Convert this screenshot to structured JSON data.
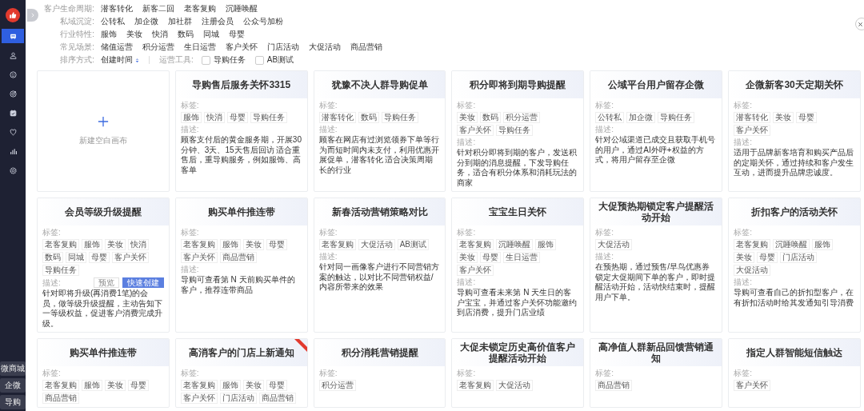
{
  "sidebar": {
    "items": [
      {
        "selected": true
      },
      {
        "selected": false
      },
      {
        "selected": false
      },
      {
        "selected": false
      },
      {
        "selected": false
      },
      {
        "selected": false
      },
      {
        "selected": false
      },
      {
        "selected": false
      }
    ],
    "bottom_links": [
      "微商城",
      "企微",
      "导购"
    ]
  },
  "filters": [
    {
      "label": "客户生命周期:",
      "options": [
        "潜客转化",
        "新客二回",
        "老客复购",
        "沉睡唤醒"
      ]
    },
    {
      "label": "私域沉淀:",
      "options": [
        "公转私",
        "加企微",
        "加社群",
        "注册会员",
        "公众号加粉"
      ]
    },
    {
      "label": "行业特性:",
      "options": [
        "服饰",
        "美妆",
        "快消",
        "数码",
        "同城",
        "母婴"
      ]
    },
    {
      "label": "常见场景:",
      "options": [
        "储值运营",
        "积分运营",
        "生日运营",
        "客户关怀",
        "门店活动",
        "大促活动",
        "商品营销"
      ]
    }
  ],
  "sort": {
    "label": "排序方式:",
    "value": "创建时间",
    "tools_label": "运营工具:",
    "tools": [
      {
        "label": "导购任务",
        "checked": false
      },
      {
        "label": "AB测试",
        "checked": false
      }
    ]
  },
  "cards": [
    {
      "kind": "new",
      "title": "新建空白画布"
    },
    {
      "kind": "template",
      "title": "导购售后服务关怀3315",
      "corner_badge": false,
      "tags_label": "标签:",
      "tags": [
        "服饰",
        "快消",
        "母婴",
        "导购任务"
      ],
      "desc_label": "描述:",
      "description": "顾客支付后的黄金服务期，开展30分钟、3天、15天售后回访 适合重售后，重导购服务，例如服饰、高客单"
    },
    {
      "kind": "template",
      "title": "犹豫不决人群导购促单",
      "corner_badge": false,
      "tags_label": "标签:",
      "tags": [
        "潜客转化",
        "数码",
        "导购任务"
      ],
      "desc_label": "描述:",
      "description": "顾客在网店有过浏览领券下单等行为而短时间内未支付，利用优惠开展促单，潜客转化 适合决策周期长的行业"
    },
    {
      "kind": "template",
      "title": "积分即将到期导购提醒",
      "corner_badge": false,
      "tags_label": "标签:",
      "tags": [
        "美妆",
        "数码",
        "积分运营",
        "客户关怀",
        "导购任务"
      ],
      "desc_label": "描述:",
      "description": "针对积分即将到期的客户，发送积分到期的消息提醒，下发导购任务，适合有积分体系和消耗玩法的商家"
    },
    {
      "kind": "template",
      "title": "公域平台用户留存企微",
      "corner_badge": false,
      "tags_label": "标签:",
      "tags": [
        "公转私",
        "加企微",
        "导购任务"
      ],
      "desc_label": "描述:",
      "description": "针对公域渠道已成交且获取手机号的用户，通过AI外呼+权益的方式，将用户留存至企微"
    },
    {
      "kind": "template",
      "title": "企微新客30天定期关怀",
      "corner_badge": false,
      "tags_label": "标签:",
      "tags": [
        "潜客转化",
        "美妆",
        "母婴",
        "客户关怀"
      ],
      "desc_label": "描述:",
      "description": "适用于品牌新客培育和购买产品后的定期关怀，通过持续和客户发生互动，进而提升品牌忠诚度。"
    },
    {
      "kind": "template",
      "title": "会员等级升级提醒",
      "corner_badge": false,
      "tags_label": "标签:",
      "tags": [
        "老客复购",
        "服饰",
        "美妆",
        "快消",
        "数码",
        "同城",
        "母婴",
        "客户关怀",
        "导购任务"
      ],
      "desc_label": "描述:",
      "description": "针对即将升级(再消费1笔)的会员，做等级升级提醒，主动告知下一等级权益，促进客户消费完成升级。",
      "actions": [
        {
          "label": "预览",
          "kind": "secondary"
        },
        {
          "label": "快速创建",
          "kind": "primary"
        }
      ]
    },
    {
      "kind": "template",
      "title": "购买单件推连带",
      "corner_badge": false,
      "tags_label": "标签:",
      "tags": [
        "老客复购",
        "服饰",
        "美妆",
        "母婴",
        "客户关怀",
        "商品营销"
      ],
      "desc_label": "描述:",
      "description": "导购可查看第 N 天前购买单件的客户，推荐连带商品"
    },
    {
      "kind": "template",
      "title": "新春活动营销策略对比",
      "corner_badge": false,
      "tags_label": "标签:",
      "tags": [
        "老客复购",
        "大促活动",
        "AB测试"
      ],
      "desc_label": "描述:",
      "description": "针对同一画像客户进行不同营销方案的触达，以对比不同营销权益/内容所带来的效果"
    },
    {
      "kind": "template",
      "title": "宝宝生日关怀",
      "corner_badge": false,
      "tags_label": "标签:",
      "tags": [
        "老客复购",
        "沉睡唤醒",
        "服饰",
        "美妆",
        "母婴",
        "生日运营",
        "客户关怀"
      ],
      "desc_label": "描述:",
      "description": "导购可查看未来第 N 天生日的客户宝宝，并通过客户关怀功能邀约到店消费，提升门店业绩"
    },
    {
      "kind": "template",
      "title": "大促预热期锁定客户提醒活动开始",
      "corner_badge": false,
      "tags_label": "标签:",
      "tags": [
        "大促活动"
      ],
      "desc_label": "描述:",
      "description": "在预热期，通过预售/早鸟优惠券锁定大促期间下单的客户，即时提醒活动开始，活动快结束时，提醒用户下单。"
    },
    {
      "kind": "template",
      "title": "折扣客户的活动关怀",
      "corner_badge": false,
      "tags_label": "标签:",
      "tags": [
        "老客复购",
        "沉睡唤醒",
        "服饰",
        "美妆",
        "母婴",
        "门店活动",
        "大促活动"
      ],
      "desc_label": "描述:",
      "description": "导购可查看自己的折扣型客户，在有折扣活动时给其发通知引导消费"
    },
    {
      "kind": "template",
      "title": "购买单件推连带",
      "corner_badge": false,
      "tags_label": "标签:",
      "tags": [
        "老客复购",
        "服饰",
        "美妆",
        "母婴",
        "商品营销"
      ]
    },
    {
      "kind": "template",
      "title": "高消客户的门店上新通知",
      "corner_badge": true,
      "tags_label": "标签:",
      "tags": [
        "老客复购",
        "服饰",
        "美妆",
        "母婴",
        "客户关怀",
        "门店活动",
        "商品营销"
      ]
    },
    {
      "kind": "template",
      "title": "积分消耗营销提醒",
      "corner_badge": false,
      "tags_label": "标签:",
      "tags": [
        "积分运营"
      ]
    },
    {
      "kind": "template",
      "title": "大促未锁定历史高价值客户提醒活动开始",
      "corner_badge": false,
      "tags_label": "标签:",
      "tags": [
        "老客复购",
        "大促活动"
      ]
    },
    {
      "kind": "template",
      "title": "高净值人群新品回馈营销通知",
      "corner_badge": false,
      "tags_label": "标签:",
      "tags": [
        "商品营销"
      ]
    },
    {
      "kind": "template",
      "title": "指定人群智能短信触达",
      "corner_badge": false,
      "tags_label": "标签:",
      "tags": [
        "客户关怀"
      ]
    }
  ]
}
